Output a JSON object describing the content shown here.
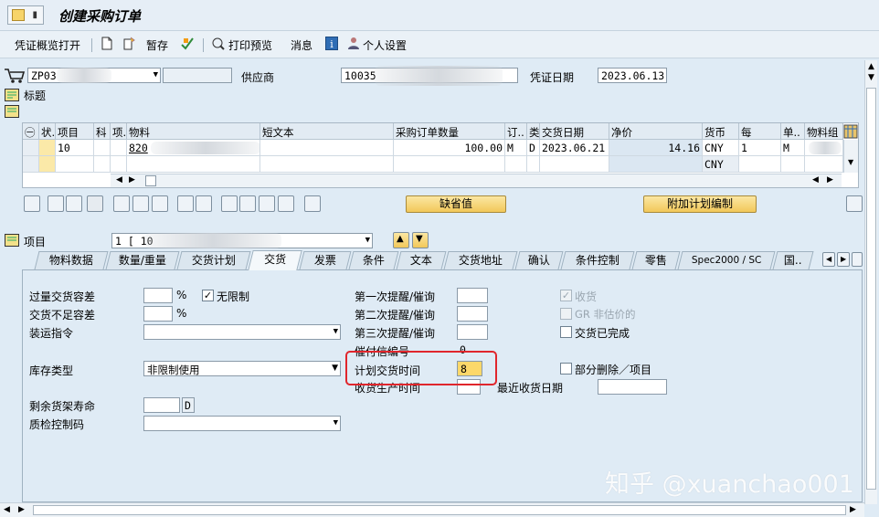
{
  "window": {
    "title": "创建采购订单"
  },
  "toolbar": {
    "doc_overview": "凭证概览打开",
    "hold": "暂存",
    "print_preview": "打印预览",
    "messages": "消息",
    "personal_settings": "个人设置"
  },
  "header": {
    "doc_type_value": "ZP03",
    "vendor_label": "供应商",
    "vendor_value": "10035",
    "doc_date_label": "凭证日期",
    "doc_date_value": "2023.06.13",
    "header_section": "标题"
  },
  "grid": {
    "columns": [
      "㊀",
      "状.",
      "项目",
      "科",
      "项.",
      "物料",
      "短文本",
      "采购订单数量",
      "订..",
      "类",
      "交货日期",
      "净价",
      "货币",
      "每",
      "单..",
      "物料组"
    ],
    "rows": [
      {
        "item": "10",
        "material": "820",
        "quantity": "100.00",
        "unit": "M",
        "cat": "D",
        "delivery_date": "2023.06.21",
        "net_price": "14.16",
        "currency": "CNY",
        "per": "1",
        "unit2": "M"
      },
      {
        "item": "",
        "material": "",
        "quantity": "",
        "unit": "",
        "cat": "",
        "delivery_date": "",
        "net_price": "",
        "currency": "CNY",
        "per": "",
        "unit2": ""
      }
    ]
  },
  "buttons": {
    "default_values": "缺省值",
    "additional_planning": "附加计划编制"
  },
  "item_detail": {
    "item_label": "项目",
    "item_value": "1 [ 10"
  },
  "tabs": [
    "物料数据",
    "数量/重量",
    "交货计划",
    "交货",
    "发票",
    "条件",
    "文本",
    "交货地址",
    "确认",
    "条件控制",
    "零售",
    "Spec2000 / SC",
    "国.."
  ],
  "delivery_tab": {
    "overdelivery_tol": "过量交货容差",
    "overdelivery_unit": "%",
    "unlimited": "无限制",
    "underdelivery_tol": "交货不足容差",
    "underdelivery_unit": "%",
    "shipping_instr": "装运指令",
    "stock_type": "库存类型",
    "stock_type_value": "非限制使用",
    "remaining_shelf_life": "剩余货架寿命",
    "shelf_life_unit": "D",
    "qm_control_key": "质检控制码",
    "reminder1": "第一次提醒/催询",
    "reminder2": "第二次提醒/催询",
    "reminder3": "第三次提醒/催询",
    "reminder_no": "催付信编号",
    "reminder_no_value": "0",
    "planned_delivery_time": "计划交货时间",
    "planned_delivery_value": "8",
    "gr_processing_time": "收货生产时间",
    "last_gr_date": "最近收货日期",
    "goods_receipt": "收货",
    "gr_non_valuated": "GR 非估价的",
    "delivery_completed": "交货已完成",
    "partial_delete": "部分删除／项目"
  },
  "watermark": "知乎 @xuanchao001"
}
